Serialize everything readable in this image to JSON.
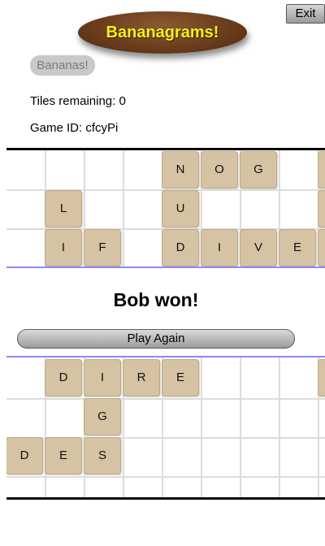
{
  "header": {
    "exit_label": "Exit",
    "logo_text": "Bananagrams!",
    "bananas_label": "Bananas!"
  },
  "status": {
    "tiles_remaining": "Tiles remaining: 0",
    "game_id": "Game ID: cfcyPi"
  },
  "winner_text": "Bob won!",
  "play_again_label": "Play Again",
  "boards": {
    "top": {
      "tiles": [
        {
          "letter": "N",
          "col": 4,
          "row": 0
        },
        {
          "letter": "O",
          "col": 5,
          "row": 0
        },
        {
          "letter": "G",
          "col": 6,
          "row": 0
        },
        {
          "letter": "",
          "col": 8,
          "row": 0
        },
        {
          "letter": "L",
          "col": 1,
          "row": 1
        },
        {
          "letter": "U",
          "col": 4,
          "row": 1
        },
        {
          "letter": "",
          "col": 8,
          "row": 1
        },
        {
          "letter": "I",
          "col": 1,
          "row": 2
        },
        {
          "letter": "F",
          "col": 2,
          "row": 2
        },
        {
          "letter": "D",
          "col": 4,
          "row": 2
        },
        {
          "letter": "I",
          "col": 5,
          "row": 2
        },
        {
          "letter": "V",
          "col": 6,
          "row": 2
        },
        {
          "letter": "E",
          "col": 7,
          "row": 2
        },
        {
          "letter": "",
          "col": 8,
          "row": 2
        }
      ]
    },
    "bottom": {
      "tiles": [
        {
          "letter": "D",
          "col": 1,
          "row": 0
        },
        {
          "letter": "I",
          "col": 2,
          "row": 0
        },
        {
          "letter": "R",
          "col": 3,
          "row": 0
        },
        {
          "letter": "E",
          "col": 4,
          "row": 0
        },
        {
          "letter": "",
          "col": 8,
          "row": 0
        },
        {
          "letter": "G",
          "col": 2,
          "row": 1
        },
        {
          "letter": "D",
          "col": 0,
          "row": 2
        },
        {
          "letter": "E",
          "col": 1,
          "row": 2
        },
        {
          "letter": "S",
          "col": 2,
          "row": 2
        }
      ]
    }
  }
}
